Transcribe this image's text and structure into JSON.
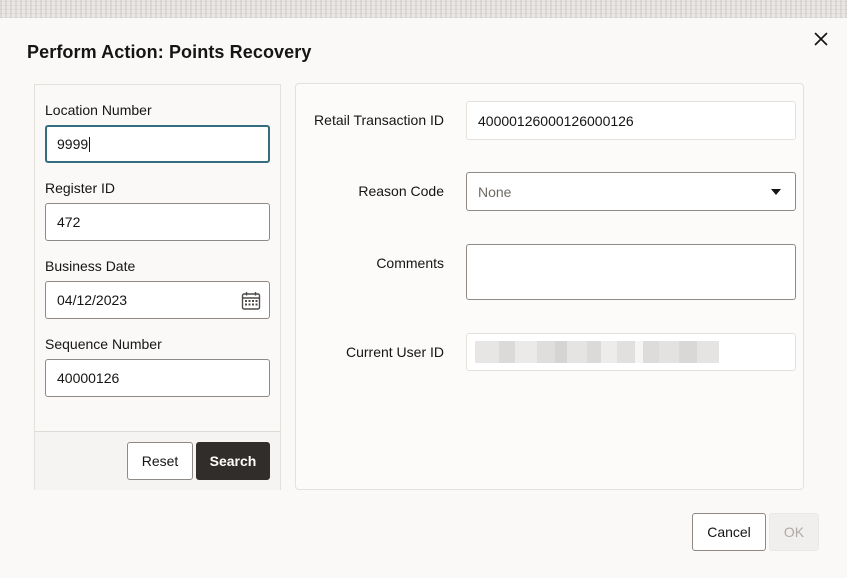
{
  "dialog": {
    "title": "Perform Action: Points Recovery"
  },
  "search_form": {
    "location_number": {
      "label": "Location Number",
      "value": "9999"
    },
    "register_id": {
      "label": "Register ID",
      "value": "472"
    },
    "business_date": {
      "label": "Business Date",
      "value": "04/12/2023"
    },
    "sequence_number": {
      "label": "Sequence Number",
      "value": "40000126"
    },
    "reset_label": "Reset",
    "search_label": "Search"
  },
  "details_form": {
    "retail_transaction_id": {
      "label": "Retail Transaction ID",
      "value": "40000126000126000126"
    },
    "reason_code": {
      "label": "Reason Code",
      "value": "None"
    },
    "comments": {
      "label": "Comments",
      "value": ""
    },
    "current_user_id": {
      "label": "Current User ID",
      "value": ""
    }
  },
  "footer": {
    "cancel_label": "Cancel",
    "ok_label": "OK"
  },
  "colors": {
    "focus_border": "#356d7e",
    "primary_button": "#312d2a",
    "page_background": "#fbf9f8"
  },
  "icons": {
    "close": "close-icon",
    "calendar": "calendar-icon",
    "dropdown": "caret-down-icon"
  }
}
